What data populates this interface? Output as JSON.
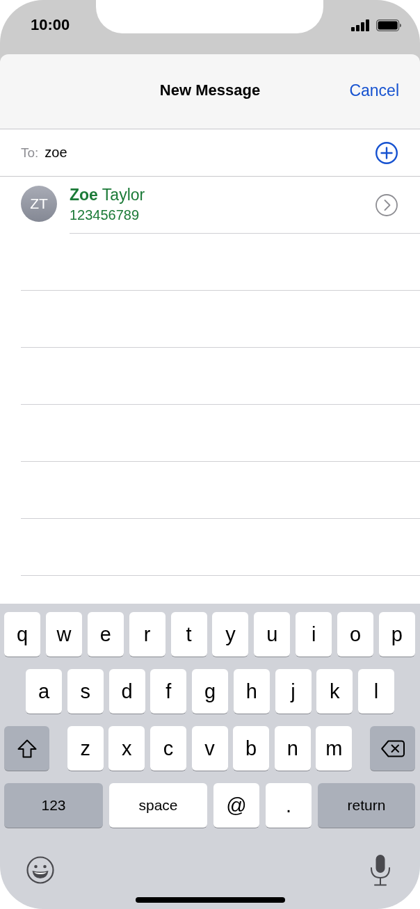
{
  "status_bar": {
    "time": "10:00"
  },
  "nav": {
    "title": "New Message",
    "cancel": "Cancel"
  },
  "to_field": {
    "label": "To:",
    "value": "zoe"
  },
  "suggestions": [
    {
      "initials": "ZT",
      "name": "**Zoe** Taylor",
      "phone": "123456789"
    }
  ],
  "keyboard": {
    "rows": [
      {
        "keys": [
          {
            "label": "q",
            "kind": "letter"
          },
          {
            "label": "w",
            "kind": "letter"
          },
          {
            "label": "e",
            "kind": "letter"
          },
          {
            "label": "r",
            "kind": "letter"
          },
          {
            "label": "t",
            "kind": "letter"
          },
          {
            "label": "y",
            "kind": "letter"
          },
          {
            "label": "u",
            "kind": "letter"
          },
          {
            "label": "i",
            "kind": "letter"
          },
          {
            "label": "o",
            "kind": "letter"
          },
          {
            "label": "p",
            "kind": "letter"
          }
        ]
      },
      {
        "keys": [
          {
            "label": "a",
            "kind": "letter"
          },
          {
            "label": "s",
            "kind": "letter"
          },
          {
            "label": "d",
            "kind": "letter"
          },
          {
            "label": "f",
            "kind": "letter"
          },
          {
            "label": "g",
            "kind": "letter"
          },
          {
            "label": "h",
            "kind": "letter"
          },
          {
            "label": "j",
            "kind": "letter"
          },
          {
            "label": "k",
            "kind": "letter"
          },
          {
            "label": "l",
            "kind": "letter"
          }
        ]
      },
      {
        "keys": [
          {
            "kind": "shift"
          },
          {
            "label": "z",
            "kind": "letter"
          },
          {
            "label": "x",
            "kind": "letter"
          },
          {
            "label": "c",
            "kind": "letter"
          },
          {
            "label": "v",
            "kind": "letter"
          },
          {
            "label": "b",
            "kind": "letter"
          },
          {
            "label": "n",
            "kind": "letter"
          },
          {
            "label": "m",
            "kind": "letter"
          },
          {
            "kind": "backspace"
          }
        ]
      },
      {
        "keys": [
          {
            "label": "123",
            "kind": "numbers"
          },
          {
            "label": "space",
            "kind": "space"
          },
          {
            "label": "@",
            "kind": "symbol"
          },
          {
            "label": ".",
            "kind": "symbol"
          },
          {
            "label": "return",
            "kind": "return"
          }
        ]
      }
    ]
  }
}
